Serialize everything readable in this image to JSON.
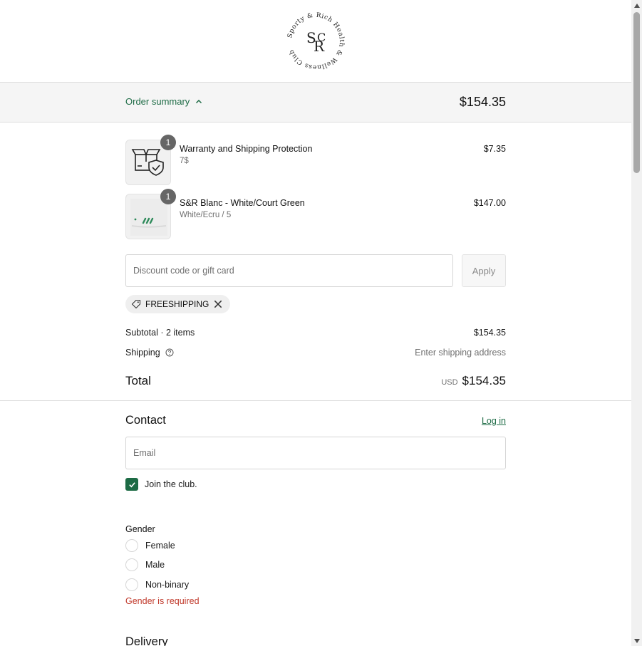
{
  "brand": {
    "monogram_top": "S",
    "monogram_mid": "R",
    "monogram_right": "C",
    "ring_text": "Sporty & Rich Health & Wellness Club "
  },
  "summary_bar": {
    "toggle_label": "Order summary",
    "total": "$154.35"
  },
  "line_items": [
    {
      "title": "Warranty and Shipping Protection",
      "variant": "7$",
      "price": "$7.35",
      "quantity": "1",
      "thumb_icon": "box-shield-icon"
    },
    {
      "title": "S&R Blanc - White/Court Green",
      "variant": "White/Ecru / 5",
      "price": "$147.00",
      "quantity": "1",
      "thumb_icon": "sneaker-image"
    }
  ],
  "discount": {
    "placeholder": "Discount code or gift card",
    "apply_label": "Apply",
    "applied_code": "FREESHIPPING"
  },
  "totals": {
    "subtotal_label": "Subtotal · 2 items",
    "subtotal_value": "$154.35",
    "shipping_label": "Shipping",
    "shipping_value": "Enter shipping address",
    "total_label": "Total",
    "currency": "USD",
    "total_value": "$154.35"
  },
  "contact": {
    "heading": "Contact",
    "login_label": "Log in",
    "email_placeholder": "Email",
    "newsletter_label": "Join the club.",
    "newsletter_checked": true
  },
  "gender": {
    "label": "Gender",
    "options": [
      "Female",
      "Male",
      "Non-binary"
    ],
    "error": "Gender is required"
  },
  "delivery": {
    "heading": "Delivery"
  },
  "colors": {
    "accent": "#1d6b45",
    "error": "#c0392b",
    "muted": "#707070"
  }
}
